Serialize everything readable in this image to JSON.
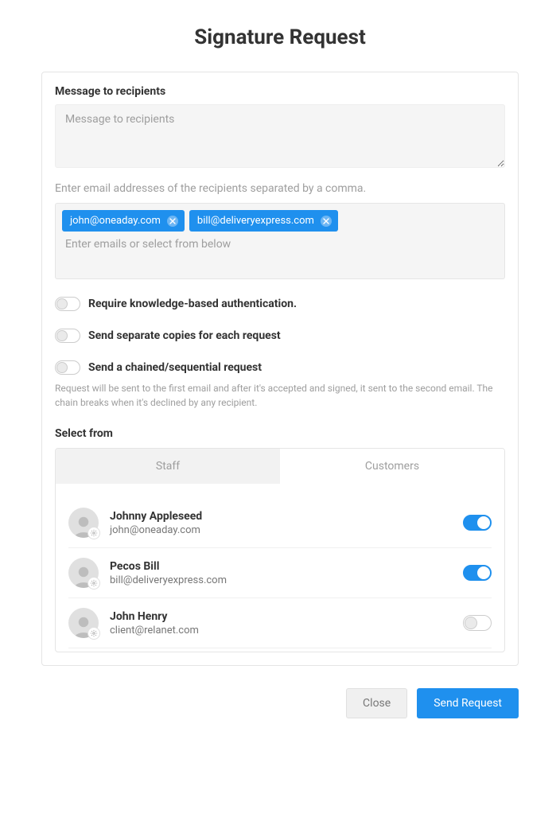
{
  "title": "Signature Request",
  "message": {
    "label": "Message to recipients",
    "placeholder": "Message to recipients",
    "value": ""
  },
  "recipients": {
    "help": "Enter email addresses of the recipients separated by a comma.",
    "placeholder": "Enter emails or select from below",
    "chips": [
      {
        "email": "john@oneaday.com"
      },
      {
        "email": "bill@deliveryexpress.com"
      }
    ]
  },
  "options": {
    "kba": {
      "label": "Require knowledge-based authentication.",
      "value": false
    },
    "separate": {
      "label": "Send separate copies for each request",
      "value": false
    },
    "chained": {
      "label": "Send a chained/sequential request",
      "value": false,
      "help": "Request will be sent to the first email and after it's accepted and signed, it sent to the second email. The chain breaks when it's declined by any recipient."
    }
  },
  "selectFrom": {
    "label": "Select from",
    "tabs": {
      "staff": "Staff",
      "customers": "Customers",
      "active": "staff"
    },
    "contacts": [
      {
        "name": "Johnny Appleseed",
        "email": "john@oneaday.com",
        "selected": true
      },
      {
        "name": "Pecos Bill",
        "email": "bill@deliveryexpress.com",
        "selected": true
      },
      {
        "name": "John Henry",
        "email": "client@relanet.com",
        "selected": false
      }
    ]
  },
  "footer": {
    "close": "Close",
    "send": "Send Request"
  },
  "colors": {
    "primary": "#1f90ee"
  }
}
